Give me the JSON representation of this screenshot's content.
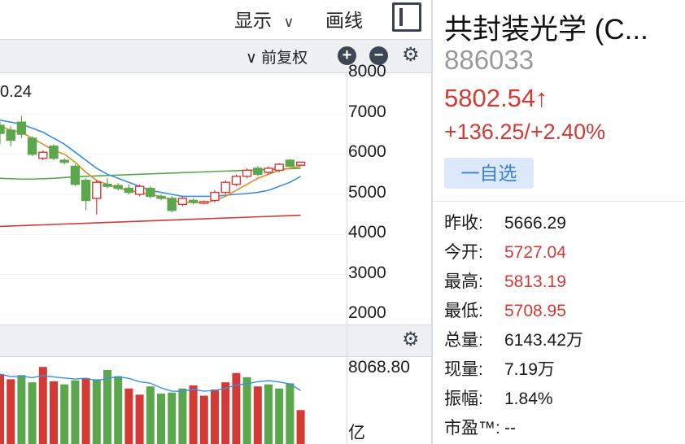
{
  "toolbar": {
    "display_label": "显示",
    "display_caret": "∨",
    "draw_label": "画线"
  },
  "chart_toolbar": {
    "adjust_label": "∨ 前复权",
    "zoom_in": "+",
    "zoom_out": "−"
  },
  "kline": {
    "last_value_label": "0.24",
    "y_ticks": [
      "8000",
      "7000",
      "6000",
      "5000",
      "4000",
      "3000",
      "2000"
    ]
  },
  "volume": {
    "max_label": "8068.80",
    "unit_label": "亿"
  },
  "quote": {
    "name": "共封装光学 (C...",
    "code": "886033",
    "price": "5802.54↑",
    "change": "+136.25/+2.40%",
    "watch_label": "一自选",
    "stats": [
      {
        "label": "昨收:",
        "value": "5666.29",
        "color": "normal"
      },
      {
        "label": "今开:",
        "value": "5727.04",
        "color": "red"
      },
      {
        "label": "最高:",
        "value": "5813.19",
        "color": "red"
      },
      {
        "label": "最低:",
        "value": "5708.95",
        "color": "red"
      },
      {
        "label": "总量:",
        "value": "6143.42万",
        "color": "normal"
      },
      {
        "label": "现量:",
        "value": "7.19万",
        "color": "normal"
      },
      {
        "label": "振幅:",
        "value": "1.84%",
        "color": "normal"
      },
      {
        "label": "市盈™:",
        "value": "--",
        "color": "normal"
      }
    ]
  },
  "colors": {
    "up": "#d33a35",
    "down": "#5aa74d",
    "ma_blue": "#3a8ee6",
    "ma_orange": "#e48a2a",
    "ma_green": "#55a84a",
    "ma_red": "#d33a35"
  },
  "chart_data": {
    "type": "candlestick",
    "y_range": [
      2000,
      8000
    ],
    "candles": [
      {
        "o": 6720,
        "c": 6520,
        "h": 6800,
        "l": 6250
      },
      {
        "o": 6600,
        "c": 6350,
        "h": 6700,
        "l": 6200
      },
      {
        "o": 6800,
        "c": 6500,
        "h": 6950,
        "l": 6400
      },
      {
        "o": 6400,
        "c": 6000,
        "h": 6450,
        "l": 5950
      },
      {
        "o": 5900,
        "c": 6050,
        "h": 6100,
        "l": 5850
      },
      {
        "o": 6200,
        "c": 5900,
        "h": 6250,
        "l": 5850
      },
      {
        "o": 5850,
        "c": 5800,
        "h": 5900,
        "l": 5750
      },
      {
        "o": 5700,
        "c": 5250,
        "h": 5750,
        "l": 5200
      },
      {
        "o": 5350,
        "c": 4850,
        "h": 5400,
        "l": 4600
      },
      {
        "o": 4900,
        "c": 5300,
        "h": 5350,
        "l": 4500
      },
      {
        "o": 5250,
        "c": 5200,
        "h": 5400,
        "l": 5150
      },
      {
        "o": 5220,
        "c": 5150,
        "h": 5280,
        "l": 5100
      },
      {
        "o": 5150,
        "c": 5050,
        "h": 5250,
        "l": 5000
      },
      {
        "o": 5000,
        "c": 5200,
        "h": 5250,
        "l": 4950
      },
      {
        "o": 5150,
        "c": 4950,
        "h": 5200,
        "l": 4900
      },
      {
        "o": 4950,
        "c": 4900,
        "h": 5000,
        "l": 4850
      },
      {
        "o": 4900,
        "c": 4600,
        "h": 4950,
        "l": 4550
      },
      {
        "o": 4750,
        "c": 4900,
        "h": 4950,
        "l": 4700
      },
      {
        "o": 4850,
        "c": 4800,
        "h": 4900,
        "l": 4750
      },
      {
        "o": 4780,
        "c": 4820,
        "h": 4850,
        "l": 4750
      },
      {
        "o": 4850,
        "c": 5050,
        "h": 5100,
        "l": 4800
      },
      {
        "o": 5050,
        "c": 5300,
        "h": 5350,
        "l": 5000
      },
      {
        "o": 5250,
        "c": 5450,
        "h": 5500,
        "l": 5200
      },
      {
        "o": 5450,
        "c": 5600,
        "h": 5650,
        "l": 5400
      },
      {
        "o": 5650,
        "c": 5500,
        "h": 5700,
        "l": 5450
      },
      {
        "o": 5550,
        "c": 5650,
        "h": 5700,
        "l": 5500
      },
      {
        "o": 5600,
        "c": 5750,
        "h": 5780,
        "l": 5550
      },
      {
        "o": 5850,
        "c": 5700,
        "h": 5880,
        "l": 5680
      },
      {
        "o": 5727.04,
        "c": 5802.54,
        "h": 5813.19,
        "l": 5708.95
      }
    ],
    "ma_blue": [
      6850,
      6800,
      6750,
      6650,
      6550,
      6400,
      6250,
      6050,
      5850,
      5650,
      5500,
      5400,
      5300,
      5200,
      5100,
      5050,
      5000,
      4950,
      4950,
      4950,
      4950,
      4980,
      5000,
      5020,
      5050,
      5100,
      5200,
      5300,
      5450
    ],
    "ma_orange": [
      6700,
      6600,
      6550,
      6400,
      6250,
      6100,
      6000,
      5800,
      5550,
      5350,
      5250,
      5150,
      5100,
      5050,
      5000,
      4950,
      4850,
      4800,
      4800,
      4780,
      4850,
      4950,
      5100,
      5250,
      5400,
      5500,
      5600,
      5650,
      5700
    ],
    "ma_green": [
      5400,
      5390,
      5380,
      5380,
      5390,
      5400,
      5420,
      5440,
      5450,
      5460,
      5470,
      5480,
      5490,
      5500,
      5510,
      5520,
      5530,
      5540,
      5550,
      5560,
      5570,
      5580,
      5590,
      5600,
      5610,
      5620,
      5630,
      5640,
      5650
    ],
    "ma_red": [
      4200,
      4210,
      4220,
      4230,
      4240,
      4250,
      4260,
      4270,
      4280,
      4290,
      4300,
      4310,
      4320,
      4330,
      4340,
      4350,
      4360,
      4370,
      4380,
      4390,
      4400,
      4410,
      4420,
      4430,
      4440,
      4450,
      4460,
      4470,
      4480
    ],
    "volumes": [
      1,
      1,
      0,
      0,
      1,
      1,
      0,
      0,
      1,
      0,
      0,
      0,
      1,
      1,
      0,
      0,
      0,
      0,
      1,
      1,
      1,
      1,
      1,
      0,
      1,
      0,
      0,
      0,
      1
    ],
    "volume_values": [
      6800,
      6300,
      6700,
      6000,
      7500,
      6100,
      5800,
      6200,
      6400,
      6300,
      7200,
      6600,
      5400,
      4800,
      5600,
      4900,
      5000,
      5400,
      5700,
      4700,
      5300,
      6000,
      6900,
      6500,
      5600,
      5800,
      5400,
      5900,
      3300
    ],
    "volume_range": [
      0,
      8068.8
    ]
  }
}
